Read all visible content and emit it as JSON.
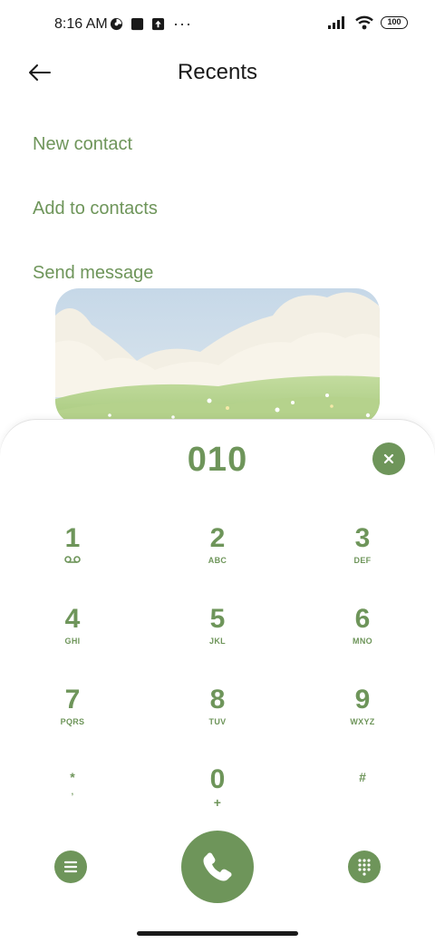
{
  "status_bar": {
    "time": "8:16 AM",
    "overflow": "···",
    "battery": "100",
    "icons": [
      "timer-icon",
      "square-icon",
      "upload-icon",
      "signal-icon",
      "wifi-icon",
      "battery-icon"
    ]
  },
  "header": {
    "title": "Recents",
    "back_icon": "arrow-left-icon"
  },
  "actions": {
    "new_contact": "New contact",
    "add_to_contacts": "Add to contacts",
    "send_message": "Send message"
  },
  "dialer": {
    "number": "010",
    "keys": [
      {
        "digit": "1",
        "sub": ""
      },
      {
        "digit": "2",
        "sub": "ABC"
      },
      {
        "digit": "3",
        "sub": "DEF"
      },
      {
        "digit": "4",
        "sub": "GHI"
      },
      {
        "digit": "5",
        "sub": "JKL"
      },
      {
        "digit": "6",
        "sub": "MNO"
      },
      {
        "digit": "7",
        "sub": "PQRS"
      },
      {
        "digit": "8",
        "sub": "TUV"
      },
      {
        "digit": "9",
        "sub": "WXYZ"
      },
      {
        "digit": "*",
        "sub": ","
      },
      {
        "digit": "0",
        "sub": "+"
      },
      {
        "digit": "#",
        "sub": ""
      }
    ]
  },
  "colors": {
    "accent": "#6e955a",
    "text": "#1a1a1a",
    "background": "#ffffff"
  }
}
